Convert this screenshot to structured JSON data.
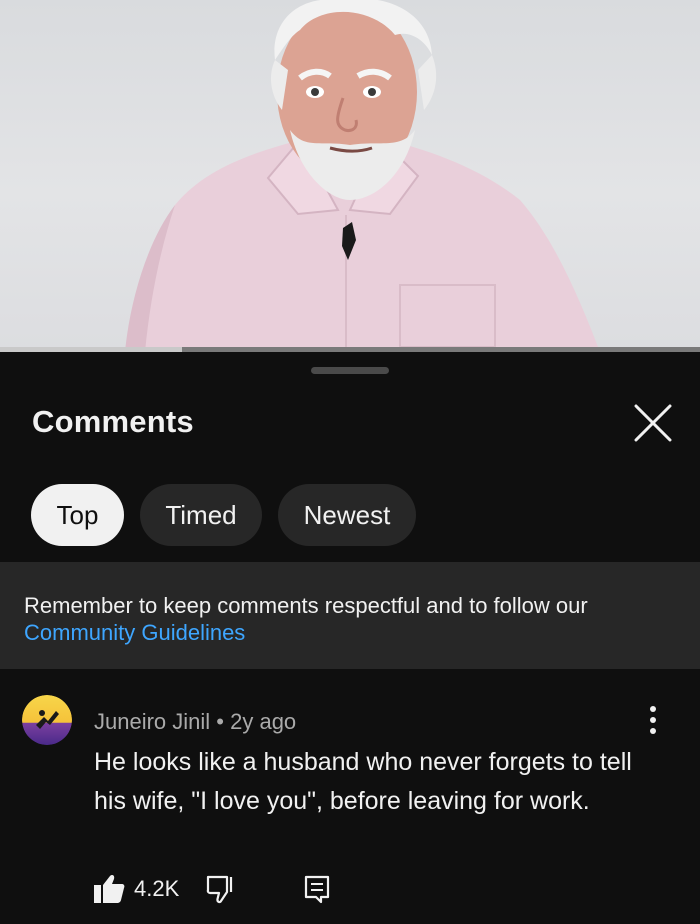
{
  "video": {
    "progress_fraction": 0.26
  },
  "comments_panel": {
    "title": "Comments",
    "close_icon": "close-icon",
    "filters": [
      {
        "label": "Top",
        "active": true
      },
      {
        "label": "Timed",
        "active": false
      },
      {
        "label": "Newest",
        "active": false
      }
    ],
    "notice": {
      "text": "Remember to keep comments respectful and to follow our ",
      "link": "Community Guidelines",
      "link_color": "#3ea6ff"
    }
  },
  "comment": {
    "author": "Juneiro Jinil",
    "separator": " • ",
    "time": "2y ago",
    "text": "He looks like a husband who never forgets to tell his wife, \"I love you\", before leaving for work.",
    "likes": "4.2K",
    "icons": {
      "like": "thumbs-up-icon",
      "dislike": "thumbs-down-icon",
      "reply": "reply-icon",
      "menu": "more-vertical-icon"
    }
  },
  "colors": {
    "background": "#0f0f0f",
    "chip": "#272727",
    "active_chip": "#f1f1f1",
    "secondary_text": "#aaaaaa"
  }
}
